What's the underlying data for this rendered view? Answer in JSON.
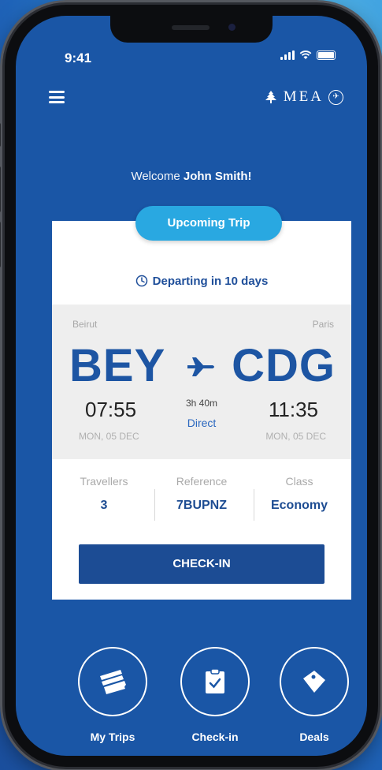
{
  "status_bar": {
    "time": "9:41"
  },
  "header": {
    "brand": "MEA"
  },
  "welcome": {
    "prefix": "Welcome",
    "name": "John Smith!"
  },
  "trip": {
    "badge": "Upcoming Trip",
    "departing": "Departing in 10 days",
    "origin": {
      "city": "Beirut",
      "code": "BEY",
      "time": "07:55",
      "date": "MON, 05 DEC"
    },
    "destination": {
      "city": "Paris",
      "code": "CDG",
      "time": "11:35",
      "date": "MON, 05 DEC"
    },
    "duration": "3h 40m",
    "stops": "Direct",
    "details": [
      {
        "label": "Travellers",
        "value": "3"
      },
      {
        "label": "Reference",
        "value": "7BUPNZ"
      },
      {
        "label": "Class",
        "value": "Economy"
      }
    ],
    "checkin_label": "CHECK-IN"
  },
  "bottom_nav": [
    {
      "label": "My Trips",
      "icon": "tickets-icon"
    },
    {
      "label": "Check-in",
      "icon": "clipboard-check-icon"
    },
    {
      "label": "Deals",
      "icon": "tag-icon"
    }
  ],
  "colors": {
    "primary": "#1a56a6",
    "accent": "#29a8e1",
    "button": "#1c4c94"
  }
}
